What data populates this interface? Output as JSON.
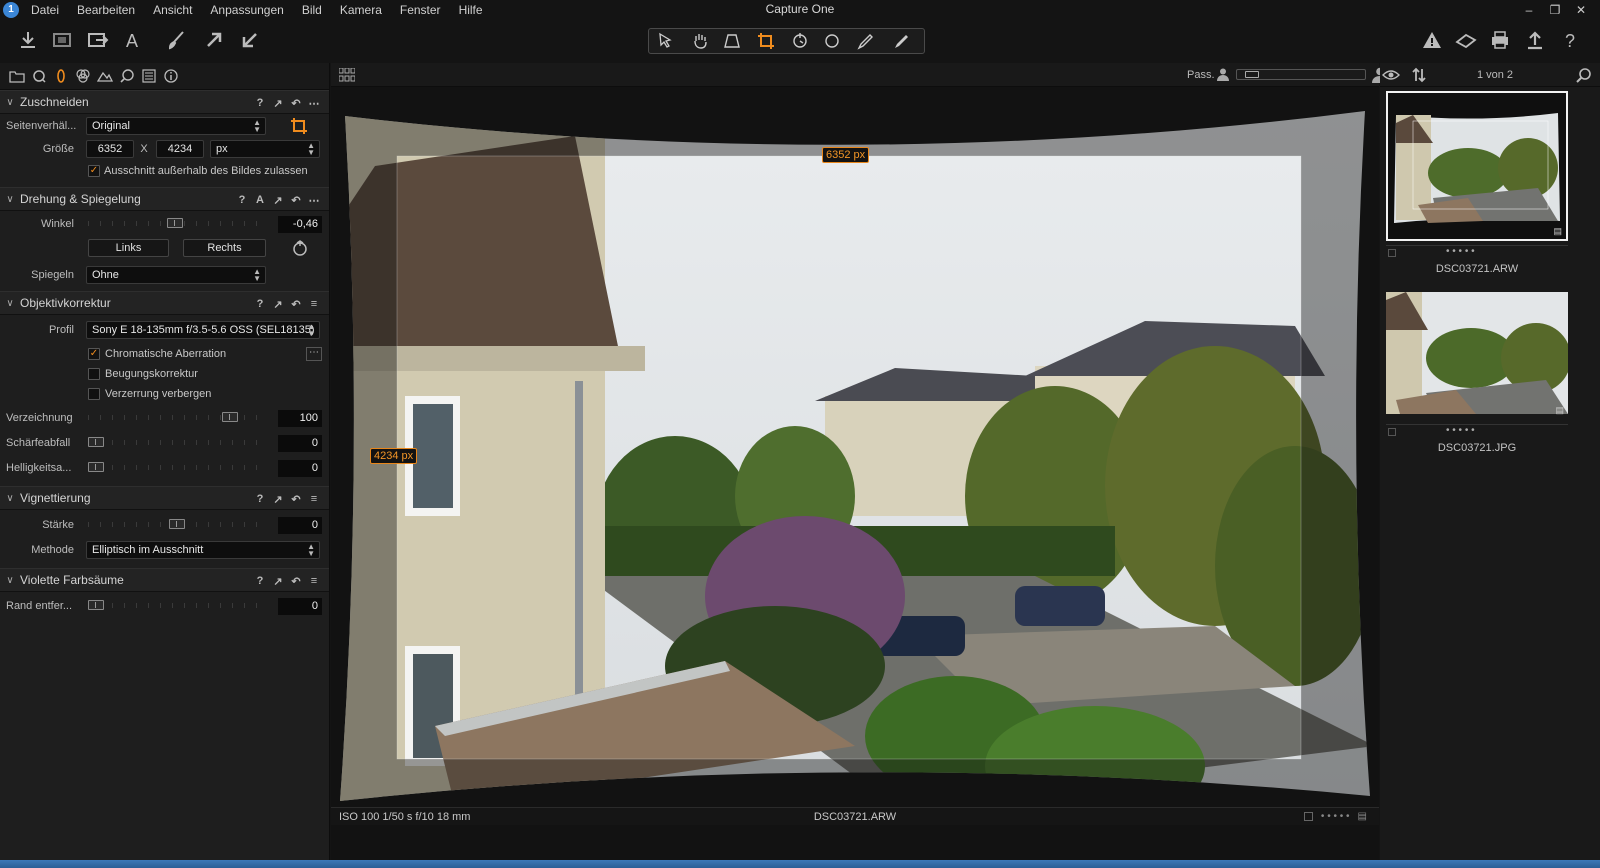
{
  "menubar": {
    "items": [
      "Datei",
      "Bearbeiten",
      "Ansicht",
      "Anpassungen",
      "Bild",
      "Kamera",
      "Fenster",
      "Hilfe"
    ],
    "title": "Capture One",
    "logo": "1"
  },
  "crop": {
    "title": "Zuschneiden",
    "ratio_label": "Seitenverhäl...",
    "ratio_value": "Original",
    "size_label": "Größe",
    "width": "6352",
    "x_sep": "X",
    "height": "4234",
    "unit": "px",
    "allow_outside_label": "Ausschnitt außerhalb des Bildes zulassen",
    "allow_outside_checked": true
  },
  "rotation": {
    "title": "Drehung & Spiegelung",
    "angle_label": "Winkel",
    "angle_value": "-0,46",
    "angle_position": 0.49,
    "left_button": "Links",
    "right_button": "Rechts",
    "mirror_label": "Spiegeln",
    "mirror_value": "Ohne"
  },
  "lens": {
    "title": "Objektivkorrektur",
    "profile_label": "Profil",
    "profile_value": "Sony E 18-135mm f/3.5-5.6 OSS (SEL18135)",
    "options": [
      {
        "label": "Chromatische Aberration",
        "checked": true
      },
      {
        "label": "Beugungskorrektur",
        "checked": false
      },
      {
        "label": "Verzerrung verbergen",
        "checked": false
      }
    ],
    "sliders": [
      {
        "label": "Verzeichnung",
        "value": "100",
        "position": 0.83
      },
      {
        "label": "Schärfeabfall",
        "value": "0",
        "position": 0.0
      },
      {
        "label": "Helligkeitsa...",
        "value": "0",
        "position": 0.0
      }
    ]
  },
  "vignetting": {
    "title": "Vignettierung",
    "strength_label": "Stärke",
    "strength_value": "0",
    "strength_position": 0.5,
    "method_label": "Methode",
    "method_value": "Elliptisch im Ausschnitt"
  },
  "purple_fringe": {
    "title": "Violette Farbsäume",
    "amount_label": "Rand entfer...",
    "amount_value": "0",
    "amount_position": 0.0
  },
  "viewer": {
    "proof_label": "Pass.",
    "zoom_position": 0.05,
    "width_badge": "6352 px",
    "height_badge": "4234 px",
    "exif": "ISO 100  1/50 s  f/10  18 mm",
    "filename": "DSC03721.ARW"
  },
  "browser": {
    "count": "1 von 2",
    "items": [
      {
        "name": "DSC03721.ARW",
        "selected": true
      },
      {
        "name": "DSC03721.JPG",
        "selected": false
      }
    ]
  },
  "colors": {
    "accent": "#f08c1e",
    "panel": "#1e1e1e",
    "background": "#141414"
  }
}
